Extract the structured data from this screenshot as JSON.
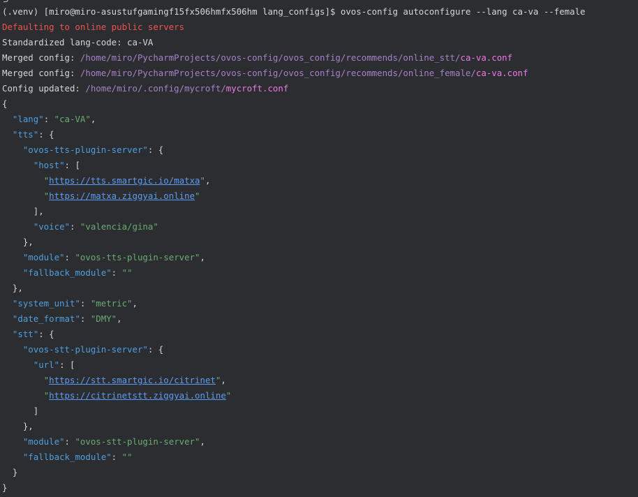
{
  "terminal": {
    "top_fragment": "}",
    "prompt": "(.venv) [miro@miro-asustufgamingf15fx506hmfx506hm lang_configs]$ ovos-config autoconfigure --lang ca-va --female",
    "warning": "Defaulting to online public servers",
    "lang_code_line": "Standardized lang-code: ca-VA",
    "merged_label": "Merged config: ",
    "merged1_dir": "/home/miro/PycharmProjects/ovos-config/ovos_config/recommends/online_stt/",
    "merged1_file": "ca-va.conf",
    "merged2_dir": "/home/miro/PycharmProjects/ovos-config/ovos_config/recommends/online_female/",
    "merged2_file": "ca-va.conf",
    "updated_label": "Config updated: ",
    "updated_dir": "/home/miro/.config/mycroft/",
    "updated_file": "mycroft.conf"
  },
  "json": {
    "open_brace": "{",
    "lang_key": "\"lang\"",
    "lang_value": "\"ca-VA\"",
    "tts_key": "\"tts\"",
    "tts_plugin_key": "\"ovos-tts-plugin-server\"",
    "host_key": "\"host\"",
    "host_urls": [
      "https://tts.smartgic.io/matxa",
      "https://matxa.ziggyai.online"
    ],
    "voice_key": "\"voice\"",
    "voice_value": "\"valencia/gina\"",
    "tts_module_key": "\"module\"",
    "tts_module_value": "\"ovos-tts-plugin-server\"",
    "tts_fallback_key": "\"fallback_module\"",
    "tts_fallback_value": "\"\"",
    "system_unit_key": "\"system_unit\"",
    "system_unit_value": "\"metric\"",
    "date_format_key": "\"date_format\"",
    "date_format_value": "\"DMY\"",
    "stt_key": "\"stt\"",
    "stt_plugin_key": "\"ovos-stt-plugin-server\"",
    "url_key": "\"url\"",
    "stt_urls": [
      "https://stt.smartgic.io/citrinet",
      "https://citrinetstt.ziggyai.online"
    ],
    "stt_module_key": "\"module\"",
    "stt_module_value": "\"ovos-stt-plugin-server\"",
    "stt_fallback_key": "\"fallback_module\"",
    "stt_fallback_value": "\"\"",
    "close_brace": "}"
  },
  "colors": {
    "background": "#2b2d30",
    "warning": "#f0524f",
    "path": "#a782c7",
    "filename": "#f078e8",
    "json_key": "#4f9fe0",
    "json_string": "#6aab73",
    "link": "#5c9cf5"
  }
}
